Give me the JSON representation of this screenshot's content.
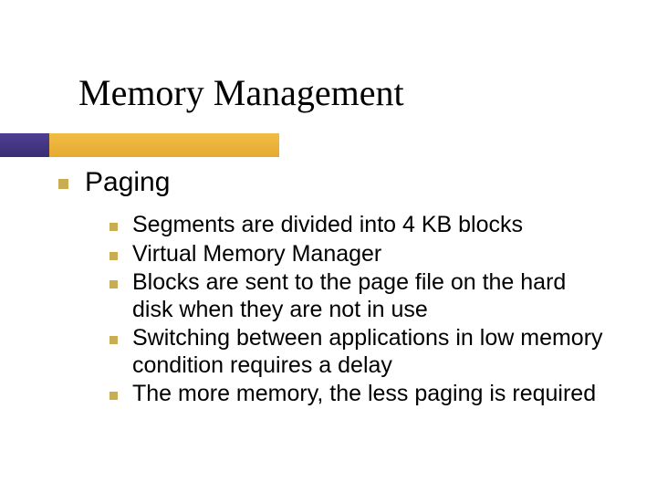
{
  "slide": {
    "title": "Memory Management",
    "section": "Paging",
    "points": [
      "Segments are divided into 4 KB blocks",
      "Virtual Memory Manager",
      "Blocks are sent to the page file on the hard disk when they are not in use",
      "Switching between applications in low memory condition requires a delay",
      "The more memory, the less paging is required"
    ]
  }
}
